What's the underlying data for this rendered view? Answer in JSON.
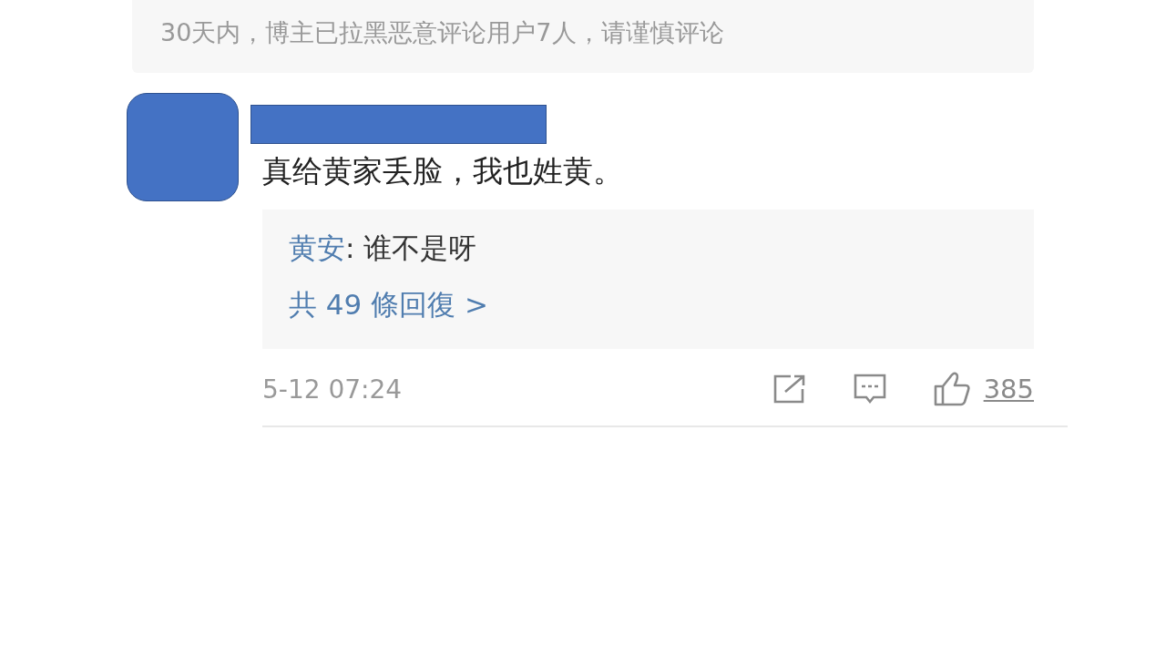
{
  "notice": "30天内，博主已拉黑恶意评论用户7人，请谨慎评论",
  "comment": {
    "text": "真给黄家丢脸，我也姓黄。",
    "reply": {
      "author": "黄安",
      "text": ": 谁不是呀"
    },
    "reply_count": "共 49 條回復 >",
    "time": "5-12 07:24",
    "likes": "385"
  }
}
